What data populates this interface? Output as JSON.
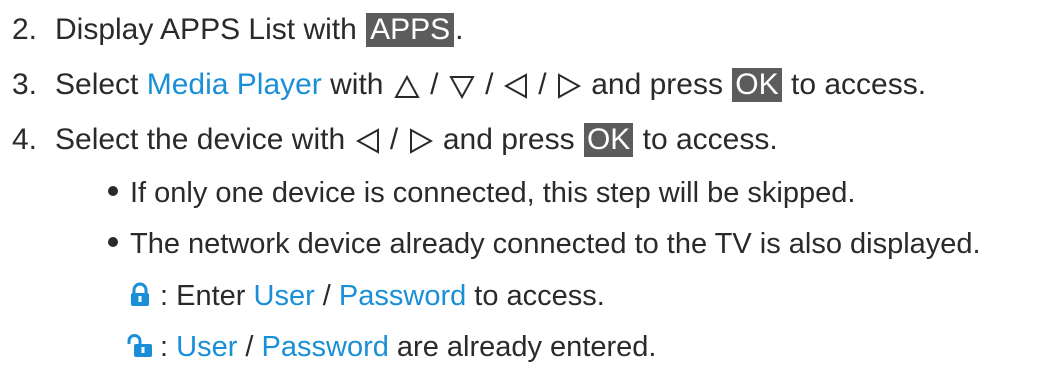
{
  "steps": [
    {
      "number": "2.",
      "parts": {
        "a": "Display APPS List with ",
        "key": "APPS",
        "b": "."
      }
    },
    {
      "number": "3.",
      "parts": {
        "a": "Select ",
        "link": "Media Player",
        "b": " with ",
        "sep1": " / ",
        "sep2": " / ",
        "sep3": " / ",
        "c": " and press ",
        "key": "OK",
        "d": " to access."
      }
    },
    {
      "number": "4.",
      "parts": {
        "a": "Select the device with ",
        "sep1": " / ",
        "c": " and press ",
        "key": "OK",
        "d": " to access."
      }
    }
  ],
  "bullets": [
    "If only one device is connected, this step will be skipped.",
    "The network device already connected to the TV is also displayed."
  ],
  "lock_rows": [
    {
      "icon": "locked-icon",
      "prefix": ": Enter ",
      "user": "User",
      "slash": " / ",
      "password": "Password",
      "suffix": " to access."
    },
    {
      "icon": "unlocked-icon",
      "prefix": ": ",
      "user": "User",
      "slash": " / ",
      "password": "Password",
      "suffix": " are already entered."
    }
  ],
  "colors": {
    "text": "#2a2a2a",
    "link": "#1a8fd8",
    "key_bg": "#5c5c5c",
    "key_text": "#ffffff",
    "lock_icon": "#1a8fd8"
  }
}
